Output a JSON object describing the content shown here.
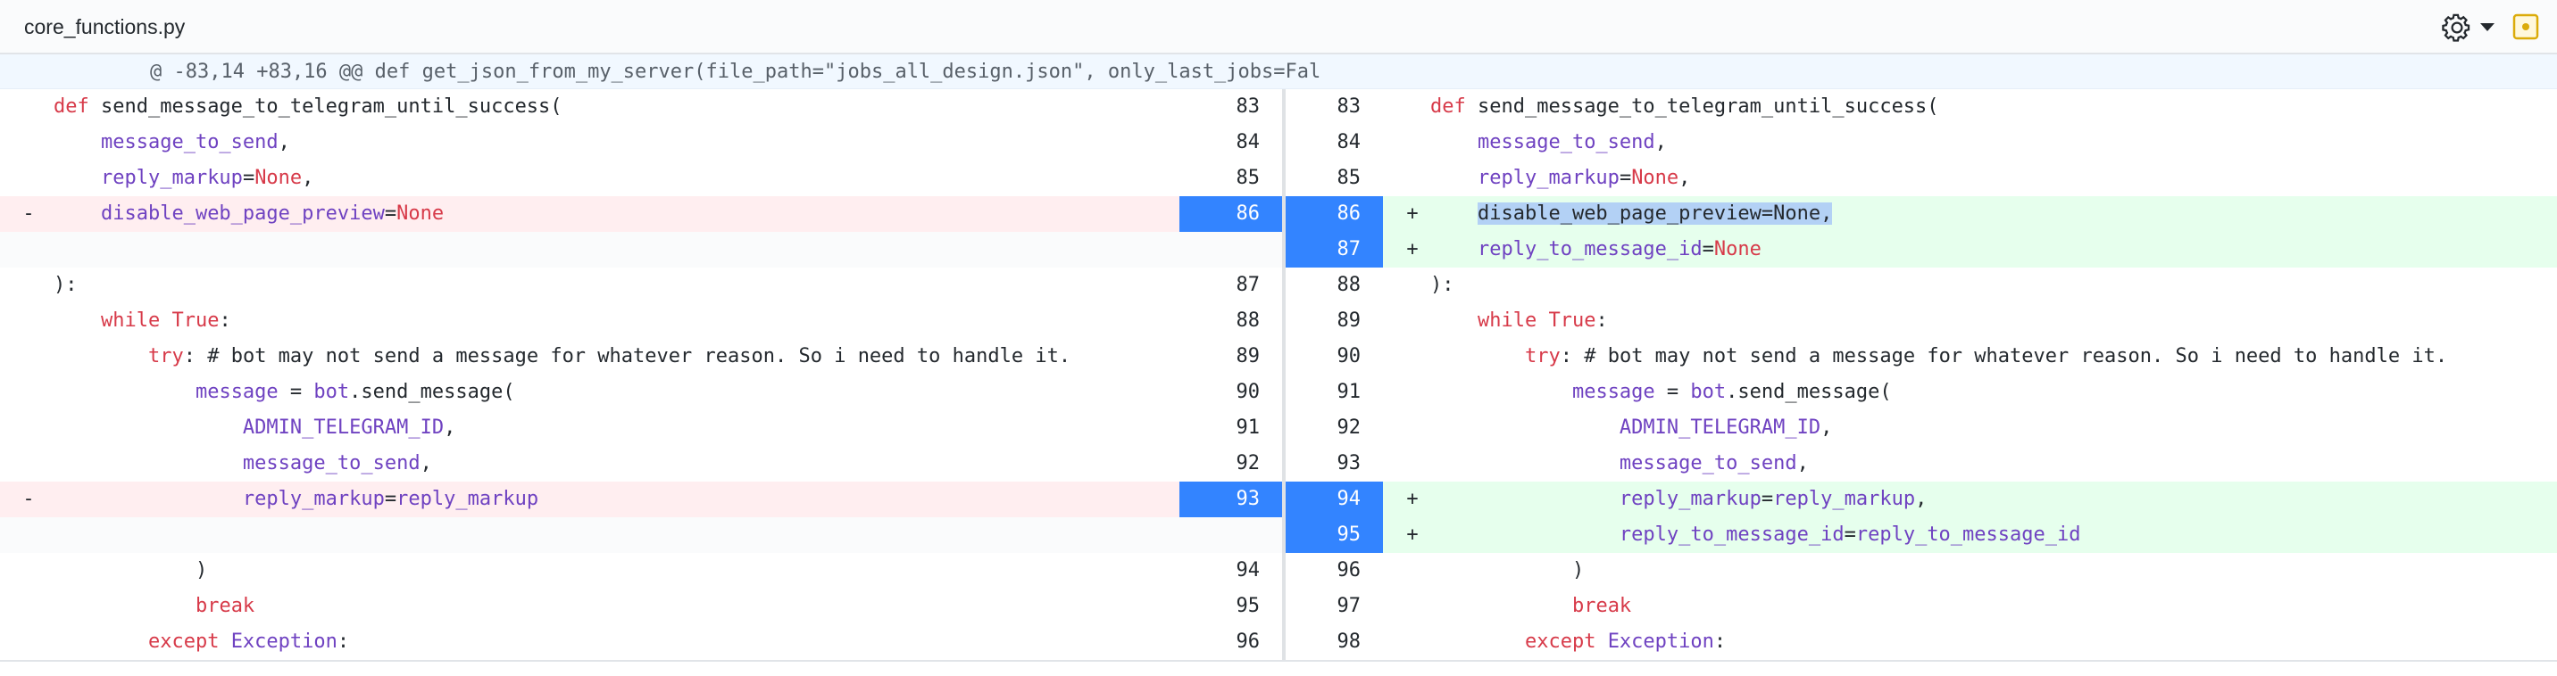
{
  "file": {
    "name": "core_functions.py"
  },
  "hunk": {
    "header": "@ -83,14 +83,16 @@ def get_json_from_my_server(file_path=\"jobs_all_design.json\", only_last_jobs=Fal"
  },
  "rows": [
    {
      "lnum": "83",
      "rnum": "83",
      "lm": "",
      "rm": "",
      "l": [
        {
          "t": "def ",
          "c": "k"
        },
        {
          "t": "send_message_to_telegram_until_success(",
          "c": "c"
        }
      ],
      "r": [
        {
          "t": "def ",
          "c": "k"
        },
        {
          "t": "send_message_to_telegram_until_success(",
          "c": "c"
        }
      ]
    },
    {
      "lnum": "84",
      "rnum": "84",
      "lm": "",
      "rm": "",
      "l": [
        {
          "t": "    "
        },
        {
          "t": "message_to_send",
          "c": "v"
        },
        {
          "t": ","
        }
      ],
      "r": [
        {
          "t": "    "
        },
        {
          "t": "message_to_send",
          "c": "v"
        },
        {
          "t": ","
        }
      ]
    },
    {
      "lnum": "85",
      "rnum": "85",
      "lm": "",
      "rm": "",
      "l": [
        {
          "t": "    "
        },
        {
          "t": "reply_markup",
          "c": "v"
        },
        {
          "t": "="
        },
        {
          "t": "None",
          "c": "k"
        },
        {
          "t": ","
        }
      ],
      "r": [
        {
          "t": "    "
        },
        {
          "t": "reply_markup",
          "c": "v"
        },
        {
          "t": "="
        },
        {
          "t": "None",
          "c": "k"
        },
        {
          "t": ","
        }
      ]
    },
    {
      "lnum": "86",
      "rnum": "86",
      "lm": "-",
      "rm": "+",
      "ltype": "del",
      "rtype": "add",
      "lsel": true,
      "rsel": true,
      "l": [
        {
          "t": "    "
        },
        {
          "t": "disable_web_page_preview",
          "c": "v"
        },
        {
          "t": "="
        },
        {
          "t": "None",
          "c": "k"
        }
      ],
      "r": [
        {
          "t": "    "
        },
        {
          "t": "disable_web_page_preview=None,",
          "c": "hl"
        }
      ]
    },
    {
      "lnum": "",
      "rnum": "87",
      "lm": "",
      "rm": "+",
      "ltype": "empty",
      "rtype": "add",
      "rsel": true,
      "l": [],
      "r": [
        {
          "t": "    "
        },
        {
          "t": "reply_to_message_id",
          "c": "v"
        },
        {
          "t": "="
        },
        {
          "t": "None",
          "c": "k"
        }
      ]
    },
    {
      "lnum": "87",
      "rnum": "88",
      "lm": "",
      "rm": "",
      "l": [
        {
          "t": "):"
        }
      ],
      "r": [
        {
          "t": "):"
        }
      ]
    },
    {
      "lnum": "88",
      "rnum": "89",
      "lm": "",
      "rm": "",
      "l": [
        {
          "t": "    "
        },
        {
          "t": "while ",
          "c": "k"
        },
        {
          "t": "True",
          "c": "k"
        },
        {
          "t": ":"
        }
      ],
      "r": [
        {
          "t": "    "
        },
        {
          "t": "while ",
          "c": "k"
        },
        {
          "t": "True",
          "c": "k"
        },
        {
          "t": ":"
        }
      ]
    },
    {
      "lnum": "89",
      "rnum": "90",
      "lm": "",
      "rm": "",
      "l": [
        {
          "t": "        "
        },
        {
          "t": "try",
          "c": "k"
        },
        {
          "t": ": # bot may not send a message for whatever reason. So i need to handle it."
        }
      ],
      "r": [
        {
          "t": "        "
        },
        {
          "t": "try",
          "c": "k"
        },
        {
          "t": ": # bot may not send a message for whatever reason. So i need to handle it."
        }
      ]
    },
    {
      "lnum": "90",
      "rnum": "91",
      "lm": "",
      "rm": "",
      "l": [
        {
          "t": "            "
        },
        {
          "t": "message",
          "c": "v"
        },
        {
          "t": " = "
        },
        {
          "t": "bot",
          "c": "v"
        },
        {
          "t": ".send_message("
        }
      ],
      "r": [
        {
          "t": "            "
        },
        {
          "t": "message",
          "c": "v"
        },
        {
          "t": " = "
        },
        {
          "t": "bot",
          "c": "v"
        },
        {
          "t": ".send_message("
        }
      ]
    },
    {
      "lnum": "91",
      "rnum": "92",
      "lm": "",
      "rm": "",
      "l": [
        {
          "t": "                "
        },
        {
          "t": "ADMIN_TELEGRAM_ID",
          "c": "v"
        },
        {
          "t": ","
        }
      ],
      "r": [
        {
          "t": "                "
        },
        {
          "t": "ADMIN_TELEGRAM_ID",
          "c": "v"
        },
        {
          "t": ","
        }
      ]
    },
    {
      "lnum": "92",
      "rnum": "93",
      "lm": "",
      "rm": "",
      "l": [
        {
          "t": "                "
        },
        {
          "t": "message_to_send",
          "c": "v"
        },
        {
          "t": ","
        }
      ],
      "r": [
        {
          "t": "                "
        },
        {
          "t": "message_to_send",
          "c": "v"
        },
        {
          "t": ","
        }
      ]
    },
    {
      "lnum": "93",
      "rnum": "94",
      "lm": "-",
      "rm": "+",
      "ltype": "del",
      "rtype": "add",
      "lsel": true,
      "rsel": true,
      "l": [
        {
          "t": "                "
        },
        {
          "t": "reply_markup",
          "c": "v"
        },
        {
          "t": "="
        },
        {
          "t": "reply_markup",
          "c": "v"
        }
      ],
      "r": [
        {
          "t": "                "
        },
        {
          "t": "reply_markup",
          "c": "v"
        },
        {
          "t": "="
        },
        {
          "t": "reply_markup",
          "c": "v"
        },
        {
          "t": ","
        }
      ]
    },
    {
      "lnum": "",
      "rnum": "95",
      "lm": "",
      "rm": "+",
      "ltype": "empty",
      "rtype": "add",
      "rsel": true,
      "l": [],
      "r": [
        {
          "t": "                "
        },
        {
          "t": "reply_to_message_id",
          "c": "v"
        },
        {
          "t": "="
        },
        {
          "t": "reply_to_message_id",
          "c": "v"
        }
      ]
    },
    {
      "lnum": "94",
      "rnum": "96",
      "lm": "",
      "rm": "",
      "l": [
        {
          "t": "            )"
        }
      ],
      "r": [
        {
          "t": "            )"
        }
      ]
    },
    {
      "lnum": "95",
      "rnum": "97",
      "lm": "",
      "rm": "",
      "l": [
        {
          "t": "            "
        },
        {
          "t": "break",
          "c": "k"
        }
      ],
      "r": [
        {
          "t": "            "
        },
        {
          "t": "break",
          "c": "k"
        }
      ]
    },
    {
      "lnum": "96",
      "rnum": "98",
      "lm": "",
      "rm": "",
      "l": [
        {
          "t": "        "
        },
        {
          "t": "except ",
          "c": "k"
        },
        {
          "t": "Exception",
          "c": "v"
        },
        {
          "t": ":"
        }
      ],
      "r": [
        {
          "t": "        "
        },
        {
          "t": "except ",
          "c": "k"
        },
        {
          "t": "Exception",
          "c": "v"
        },
        {
          "t": ":"
        }
      ]
    }
  ],
  "colors": {
    "selected_line_number": "#3384ff",
    "deleted_bg": "#ffeef0",
    "added_bg": "#e6ffed",
    "keyword": "#d73a49",
    "variable": "#6f42c1"
  },
  "icons": {
    "settings": "gear-icon",
    "dropdown": "chevron-down-icon",
    "notification": "notification-icon"
  }
}
